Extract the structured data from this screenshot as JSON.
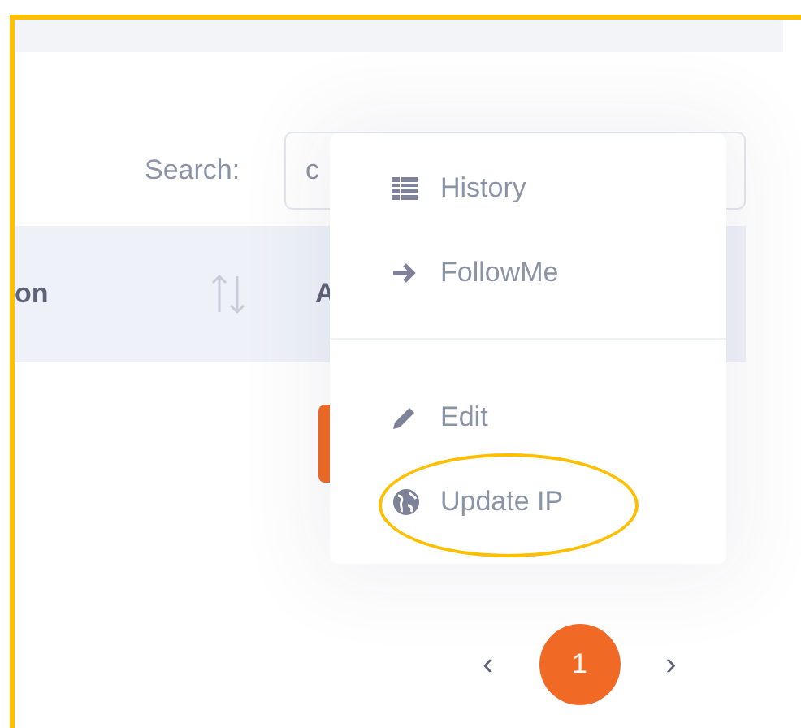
{
  "search": {
    "label": "Search:",
    "value": "c"
  },
  "table": {
    "columns": [
      {
        "label": "on"
      },
      {
        "label": "A"
      }
    ]
  },
  "menu": {
    "items": [
      {
        "kind": "item",
        "label": "History",
        "highlighted": false
      },
      {
        "kind": "item",
        "label": "FollowMe",
        "highlighted": false
      },
      {
        "kind": "divider"
      },
      {
        "kind": "item",
        "label": "Edit",
        "highlighted": false
      },
      {
        "kind": "item",
        "label": "Update IP",
        "highlighted": true
      }
    ]
  },
  "pagination": {
    "prev": "‹",
    "next": "›",
    "pages": [
      {
        "label": "1",
        "selected": true
      }
    ]
  }
}
